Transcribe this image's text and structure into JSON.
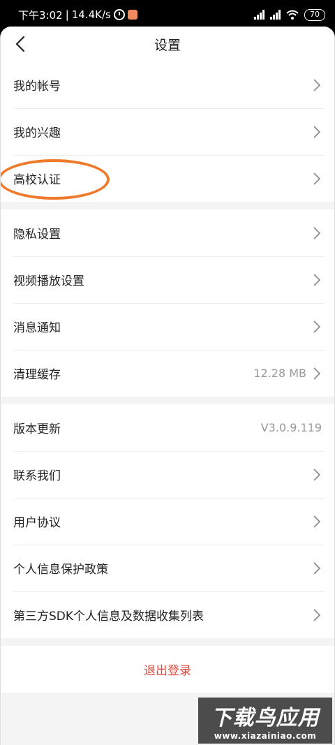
{
  "status_bar": {
    "time": "下午3:02",
    "net_speed": "14.4K/s",
    "battery": "70"
  },
  "nav": {
    "title": "设置"
  },
  "groups": [
    {
      "items": [
        {
          "label": "我的帐号"
        },
        {
          "label": "我的兴趣"
        },
        {
          "label": "高校认证"
        }
      ]
    },
    {
      "items": [
        {
          "label": "隐私设置"
        },
        {
          "label": "视频播放设置"
        },
        {
          "label": "消息通知"
        },
        {
          "label": "清理缓存",
          "value": "12.28 MB"
        }
      ]
    },
    {
      "items": [
        {
          "label": "版本更新",
          "value": "V3.0.9.119"
        },
        {
          "label": "联系我们"
        },
        {
          "label": "用户协议"
        },
        {
          "label": "个人信息保护政策"
        },
        {
          "label": "第三方SDK个人信息及数据收集列表"
        }
      ]
    }
  ],
  "logout_label": "退出登录",
  "watermark": {
    "title": "下载鸟应用",
    "url": "www.xiazainiao.com"
  },
  "colors": {
    "logout": "#e3453a",
    "highlight": "#f07a2b"
  }
}
